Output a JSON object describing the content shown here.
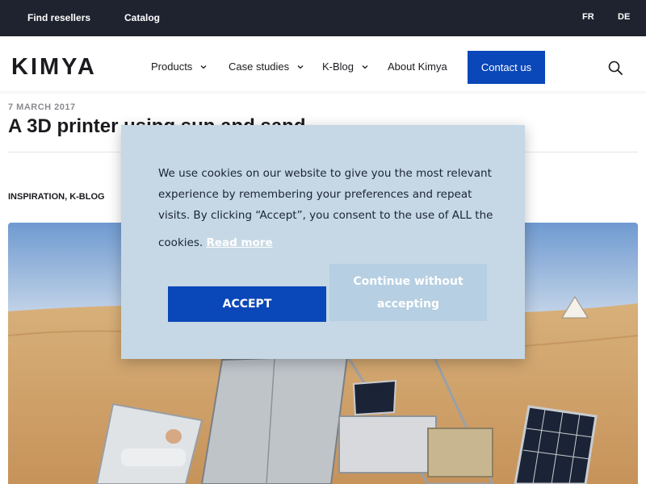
{
  "topbar": {
    "find_resellers": "Find resellers",
    "catalog": "Catalog",
    "lang_fr": "FR",
    "lang_de": "DE"
  },
  "header": {
    "logo_text": "KIMYA",
    "nav": {
      "products": "Products",
      "case_studies": "Case studies",
      "k_blog": "K-Blog",
      "about": "About Kimya"
    },
    "contact_label": "Contact us",
    "accent_color": "#0a47b8"
  },
  "article": {
    "date": "7 MARCH 2017",
    "title": "A 3D printer using sun and sand",
    "tags": "INSPIRATION, K-BLOG",
    "hero_image": "desert-solar-3d-printer-photo"
  },
  "cookie_banner": {
    "text": "We use cookies on our website to give you the most relevant experience by remembering your preferences and repeat visits. By clicking “Accept”, you consent to the use of ALL the",
    "text_end": "cookies.",
    "read_more": "Read more",
    "accept_label": "ACCEPT",
    "continue_label": "Continue without accepting",
    "background_color": "#c6d8e5"
  },
  "icons": {
    "search": "search-icon",
    "chevron": "chevron-down-icon"
  }
}
